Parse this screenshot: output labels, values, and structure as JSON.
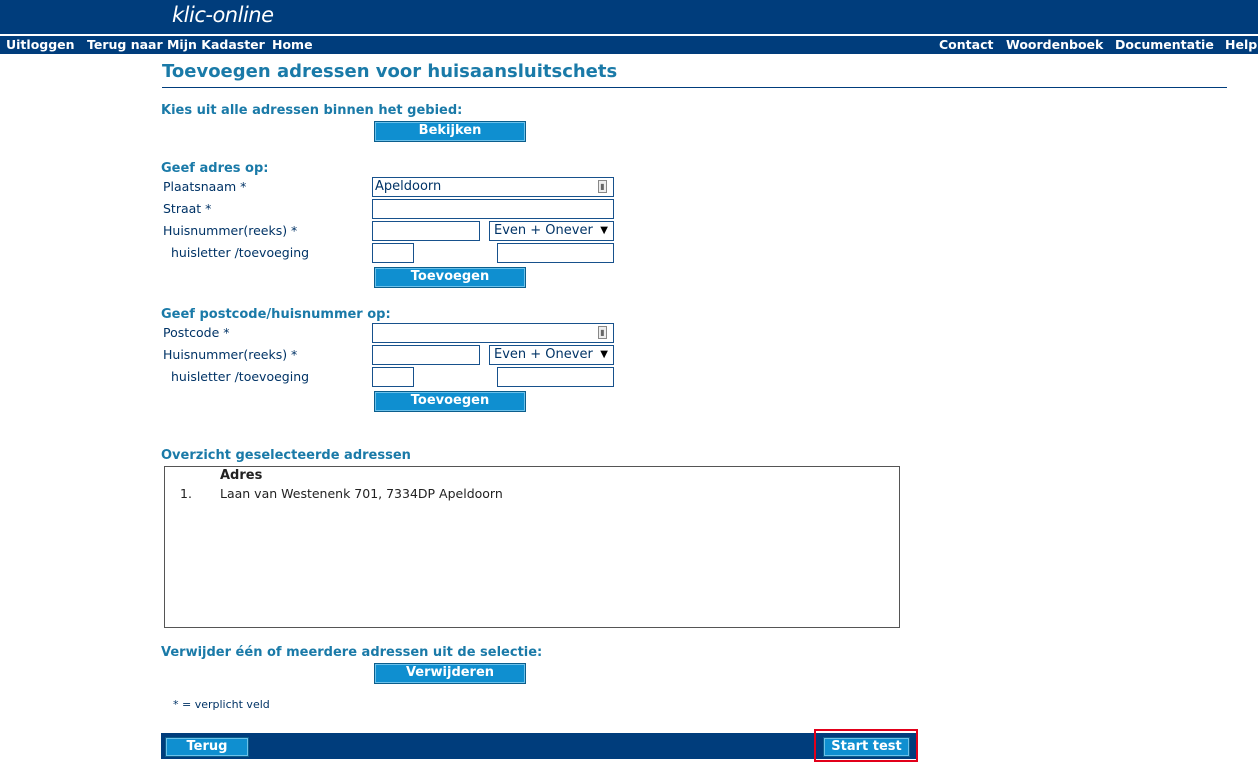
{
  "header": {
    "logo": "klic-online"
  },
  "nav": {
    "left": [
      "Uitloggen",
      "Terug naar Mijn Kadaster",
      "Home"
    ],
    "right": [
      "Contact",
      "Woordenboek",
      "Documentatie",
      "Help"
    ]
  },
  "page": {
    "title": "Toevoegen adressen voor huisaansluitschets"
  },
  "section_area": {
    "heading": "Kies uit alle adressen binnen het gebied:",
    "button": "Bekijken"
  },
  "section_address": {
    "heading": "Geef adres op:",
    "plaatsnaam_label": "Plaatsnaam *",
    "plaatsnaam_value": "Apeldoorn",
    "straat_label": "Straat *",
    "straat_value": "",
    "huisnummer_label": "Huisnummer(reeks) *",
    "huisnummer_value": "",
    "parity_option": "Even + Onever",
    "huisletter_label": "huisletter /toevoeging",
    "huisletter_value": "",
    "toevoeging_value": "",
    "button": "Toevoegen"
  },
  "section_postcode": {
    "heading": "Geef postcode/huisnummer op:",
    "postcode_label": "Postcode *",
    "postcode_value": "",
    "huisnummer_label": "Huisnummer(reeks) *",
    "huisnummer_value": "",
    "parity_option": "Even + Onever",
    "huisletter_label": "huisletter /toevoeging",
    "huisletter_value": "",
    "toevoeging_value": "",
    "button": "Toevoegen"
  },
  "overview": {
    "heading": "Overzicht geselecteerde adressen",
    "column_header": "Adres",
    "rows": [
      {
        "num": "1.",
        "address": "Laan van Westenenk 701, 7334DP Apeldoorn"
      }
    ]
  },
  "remove": {
    "heading": "Verwijder één of meerdere adressen uit de selectie:",
    "button": "Verwijderen"
  },
  "footnote": "* = verplicht veld",
  "footer": {
    "back_button": "Terug",
    "start_button": "Start test"
  },
  "colors": {
    "brand": "#003d7c",
    "heading": "#1a7aa8",
    "button": "#0f8fd0",
    "highlight": "#e2001a"
  }
}
